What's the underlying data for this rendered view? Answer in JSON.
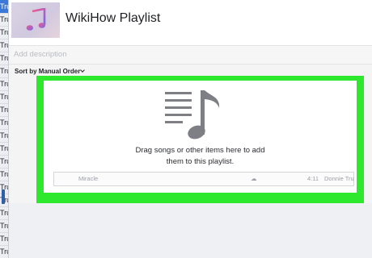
{
  "sidebar": {
    "items": [
      "Trun",
      "Trun",
      "Trun",
      "Trun",
      "Trun",
      "Trun",
      "Trun",
      "Trun",
      "Trun",
      "Trun",
      "Trun",
      "Trun",
      "Trun",
      "Trun",
      "Trun",
      "Trun",
      "Trun",
      "Trun",
      "Trun",
      "Trun"
    ]
  },
  "playlist": {
    "title": "WikiHow Playlist",
    "description_placeholder": "Add description",
    "sort_label": "Sort by Manual Order"
  },
  "dropzone": {
    "line1": "Drag songs or other items here to add",
    "line2": "them to this playlist.",
    "ghost_song": {
      "name": "Miracle",
      "cloud_icon": "☁",
      "time": "4:11",
      "artist": "Donnie Tru"
    }
  },
  "colors": {
    "highlight_border": "#2ee82e",
    "sidebar_selected": "#3a79d8"
  },
  "icons": [
    "music-note-icon",
    "list-lines-icon",
    "cloud-icon",
    "chevron-down-icon"
  ]
}
